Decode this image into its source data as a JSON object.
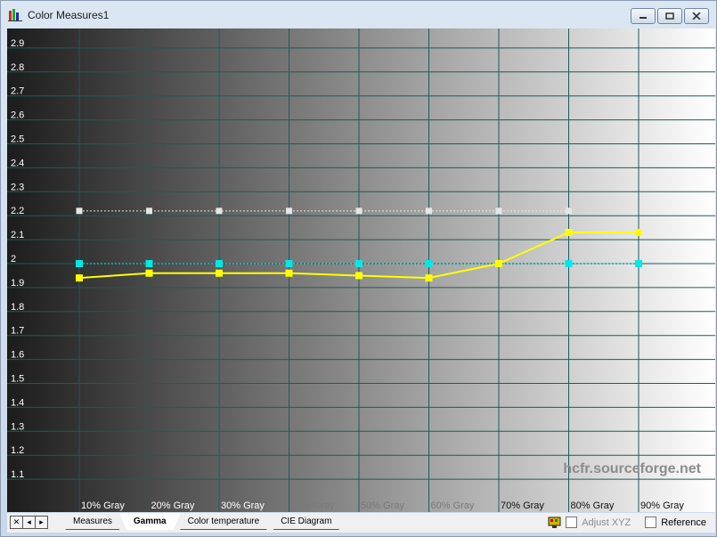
{
  "window": {
    "title": "Color Measures1"
  },
  "tabs": [
    "Measures",
    "Gamma",
    "Color temperature",
    "CIE Diagram"
  ],
  "active_tab": "Gamma",
  "nav_buttons": [
    "✕",
    "◂",
    "▸"
  ],
  "tools": {
    "adjust_xyz_label": "Adjust XYZ",
    "reference_label": "Reference"
  },
  "watermark": "hcfr.sourceforge.net",
  "colors": {
    "measured": "#ffff00",
    "reference": "#00e8e8",
    "target": "#e6e6e6",
    "grid": "#1f5a5a"
  },
  "chart_data": {
    "type": "line",
    "categories": [
      "10% Gray",
      "20% Gray",
      "30% Gray",
      "40% Gray",
      "50% Gray",
      "60% Gray",
      "70% Gray",
      "80% Gray",
      "90% Gray"
    ],
    "y_ticks": [
      "1.1",
      "1.2",
      "1.3",
      "1.4",
      "1.5",
      "1.6",
      "1.7",
      "1.8",
      "1.9",
      "2",
      "2.1",
      "2.2",
      "2.3",
      "2.4",
      "2.5",
      "2.6",
      "2.7",
      "2.8",
      "2.9"
    ],
    "ylim": [
      1.0,
      3.0
    ],
    "series": [
      {
        "values": [
          1.94,
          1.96,
          1.96,
          1.96,
          1.95,
          1.94,
          2.0,
          2.13,
          2.13
        ]
      },
      {
        "values": [
          2.0,
          2.0,
          2.0,
          2.0,
          2.0,
          2.0,
          2.0,
          2.0,
          2.0
        ]
      },
      {
        "values": [
          2.22,
          2.22,
          2.22,
          2.22,
          2.22,
          2.22,
          2.22,
          2.22
        ]
      }
    ],
    "title": "",
    "xlabel": "",
    "ylabel": "",
    "grid": true,
    "legend": "none"
  }
}
